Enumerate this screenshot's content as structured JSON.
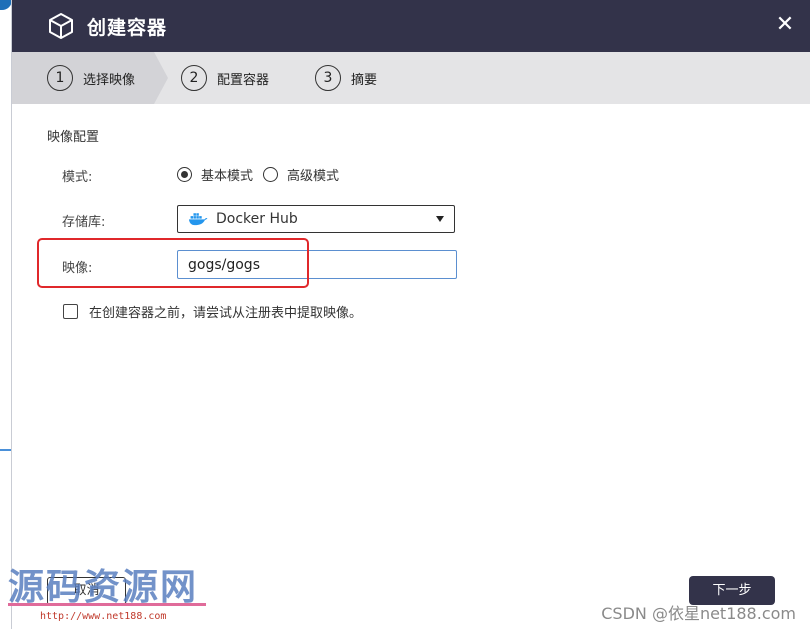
{
  "dialog": {
    "title": "创建容器",
    "title_icon": "cube-icon",
    "close_symbol": "✕"
  },
  "steps": [
    {
      "number": "1",
      "label": "选择映像",
      "active": true
    },
    {
      "number": "2",
      "label": "配置容器",
      "active": false
    },
    {
      "number": "3",
      "label": "摘要",
      "active": false
    }
  ],
  "image_config": {
    "section_title": "映像配置",
    "mode_label": "模式:",
    "mode_options": [
      {
        "label": "基本模式",
        "checked": true
      },
      {
        "label": "高级模式",
        "checked": false
      }
    ],
    "registry_label": "存储库:",
    "registry_value": "Docker Hub",
    "registry_icon": "docker-icon",
    "image_label": "映像:",
    "image_value": "gogs/gogs",
    "pull_checkbox_label": "在创建容器之前，请尝试从注册表中提取映像。",
    "pull_checkbox_checked": false
  },
  "footer": {
    "cancel_label": "取消",
    "next_label": "下一步"
  },
  "watermarks": {
    "site_name": "源码资源网",
    "site_url": "http://www.net188.com",
    "csdn": "CSDN @依星net188.com"
  },
  "colors": {
    "titlebar": "#33334a",
    "highlight": "#e0282b",
    "input_focus_border": "#5b8fd0",
    "docker_blue": "#2496ed"
  }
}
